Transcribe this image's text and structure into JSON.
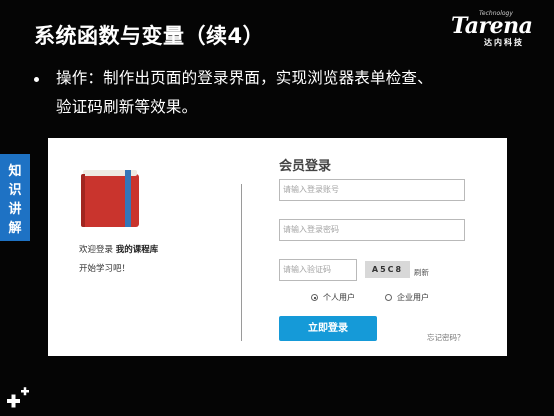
{
  "slide": {
    "title": "系统函数与变量（续4）",
    "bullet": {
      "line1": "操作：制作出页面的登录界面，实现浏览器表单检查、",
      "line2": "验证码刷新等效果。"
    }
  },
  "logo": {
    "main": "Tarena",
    "tech": "Technology",
    "sub": "达内科技"
  },
  "side_tab": {
    "chars": [
      "知",
      "识",
      "讲",
      "解"
    ]
  },
  "login_panel": {
    "welcome_prefix": "欢迎登录",
    "welcome_name": "我的课程库",
    "welcome_line2": "开始学习吧！",
    "title": "会员登录",
    "account_placeholder": "请输入登录账号",
    "password_placeholder": "请输入登录密码",
    "captcha_placeholder": "请输入验证码",
    "captcha_text": "A5C8",
    "refresh_label": "刷新",
    "radio_personal": "个人用户",
    "radio_company": "企业用户",
    "selected_user_type": "个人用户",
    "login_button": "立即登录",
    "forgot_link": "忘记密码？"
  },
  "colors": {
    "side_tab": "#1e72c4",
    "login_button": "#159ad8",
    "book_cover": "#c9342d",
    "book_ribbon": "#3476b8"
  }
}
